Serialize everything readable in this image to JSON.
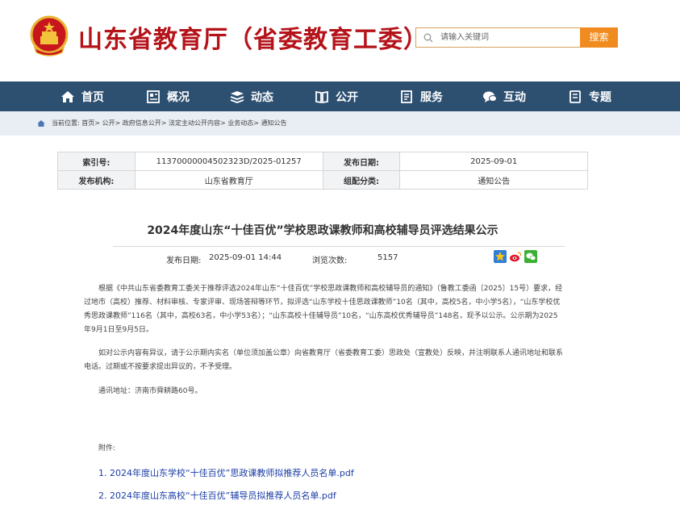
{
  "header": {
    "site_title": "山东省教育厅（省委教育工委）",
    "search_placeholder": "请输入关键词",
    "search_button": "搜索"
  },
  "nav": {
    "items": [
      {
        "label": "首页",
        "icon": "home-icon"
      },
      {
        "label": "概况",
        "icon": "overview-icon"
      },
      {
        "label": "动态",
        "icon": "news-stack-icon"
      },
      {
        "label": "公开",
        "icon": "open-book-icon"
      },
      {
        "label": "服务",
        "icon": "service-document-icon"
      },
      {
        "label": "互动",
        "icon": "chat-bubble-icon"
      },
      {
        "label": "专题",
        "icon": "topic-document-icon"
      }
    ]
  },
  "breadcrumb": {
    "text": "当前位置: 首页> 公开> 政府信息公开> 法定主动公开内容> 业务动态> 通知公告"
  },
  "meta": {
    "index_label": "索引号:",
    "index_value": "11370000004502323D/2025-01257",
    "publish_date_label": "发布日期:",
    "publish_date_value": "2025-09-01",
    "issuer_label": "发布机构:",
    "issuer_value": "山东省教育厅",
    "category_label": "组配分类:",
    "category_value": "通知公告"
  },
  "article": {
    "title": "2024年度山东“十佳百优”学校思政课教师和高校辅导员评选结果公示",
    "publish_label": "发布日期:",
    "publish_value": "2025-09-01 14:44",
    "views_label": "浏览次数:",
    "views_value": "5157",
    "paragraph1": "根据《中共山东省委教育工委关于推荐评选2024年山东“十佳百优”学校思政课教师和高校辅导员的通知》（鲁教工委函〔2025〕15号）要求，经过地市（高校）推荐、材料审核、专家评审、现场答辩等环节，拟评选“山东学校十佳思政课教师”10名（其中，高校5名，中小学5名），“山东学校优秀思政课教师”116名（其中，高校63名，中小学53名）；“山东高校十佳辅导员”10名，“山东高校优秀辅导员”148名，现予以公示。公示期为2025年9月1日至9月5日。",
    "paragraph2": "如对公示内容有异议，请于公示期内实名（单位须加盖公章）向省教育厅（省委教育工委）思政处（宣教处）反映，并注明联系人通讯地址和联系电话。过期或不按要求提出异议的，不予受理。",
    "paragraph3": "通讯地址：济南市舜耕路60号。",
    "attachments_label": "附件:",
    "attachment1": "1. 2024年度山东学校“十佳百优”思政课教师拟推荐人员名单.pdf",
    "attachment2": "2. 2024年度山东高校“十佳百优”辅导员拟推荐人员名单.pdf"
  },
  "share": [
    "qzone-star-icon",
    "weibo-icon",
    "wechat-icon"
  ],
  "colors": {
    "brand_red": "#b5131a",
    "nav_blue": "#2d4f70",
    "search_orange": "#f08c1f",
    "link_blue": "#1a3ca6"
  }
}
